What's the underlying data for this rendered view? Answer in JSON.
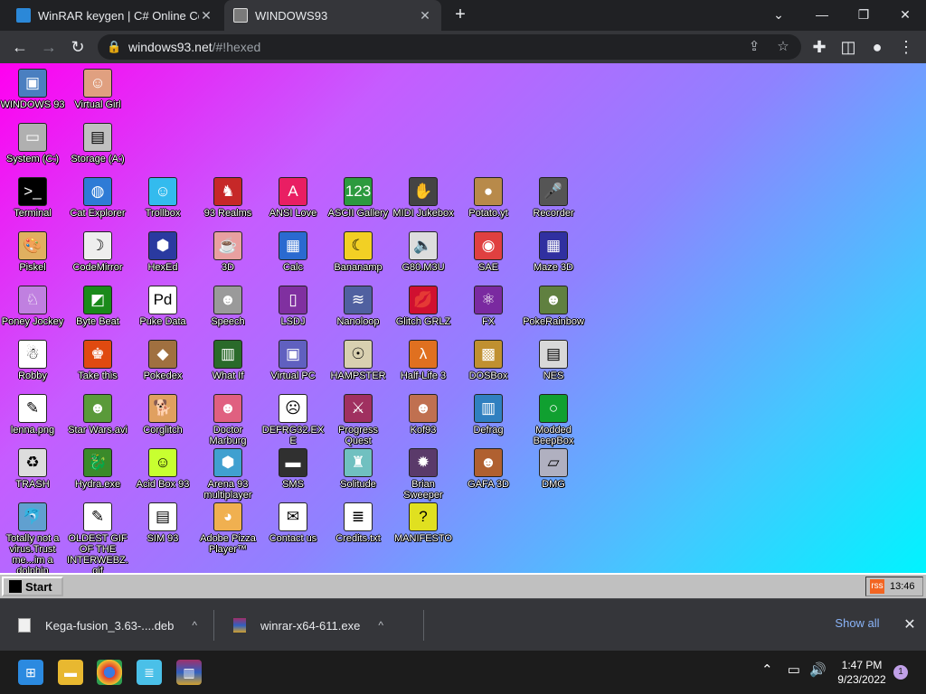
{
  "browser": {
    "tabs": [
      {
        "title": "WinRAR keygen | C# Online Com",
        "close": "✕"
      },
      {
        "title": "WINDOWS93",
        "close": "✕"
      }
    ],
    "new_tab": "+",
    "controls": {
      "chevron": "⌄",
      "minimize": "—",
      "maximize": "❐",
      "close": "✕"
    },
    "url_host": "windows93.net",
    "url_path": "/#!hexed"
  },
  "desktop": {
    "icons": [
      {
        "label": "WINDOWS 93",
        "icon": "computer-icon",
        "color": "#4a7fc0",
        "glyph": "▣"
      },
      {
        "label": "Virtual Girl",
        "icon": "face-icon",
        "color": "#e0a080",
        "glyph": "☺"
      },
      {
        "label": "System (C:)",
        "icon": "drive-icon",
        "color": "#b0b0b0",
        "glyph": "▭"
      },
      {
        "label": "Storage (A:)",
        "icon": "drive-icon",
        "color": "#c0c0c0",
        "glyph": "▤"
      },
      {
        "label": "Terminal",
        "icon": "terminal-icon",
        "color": "#000000",
        "glyph": ">_"
      },
      {
        "label": "Cat Explorer",
        "icon": "globe-icon",
        "color": "#2e7bd6",
        "glyph": "◍"
      },
      {
        "label": "Trollbox",
        "icon": "chat-icon",
        "color": "#33bbee",
        "glyph": "☺"
      },
      {
        "label": "93 Realms",
        "icon": "knight-icon",
        "color": "#c62828",
        "glyph": "♞"
      },
      {
        "label": "ANSI Love",
        "icon": "letter-a-icon",
        "color": "#e91e63",
        "glyph": "A"
      },
      {
        "label": "ASCII Gallery",
        "icon": "numbers-icon",
        "color": "#2c9a3e",
        "glyph": "123"
      },
      {
        "label": "MIDI Jukebox",
        "icon": "hand-icon",
        "color": "#444444",
        "glyph": "✋"
      },
      {
        "label": "Potato.yt",
        "icon": "potato-icon",
        "color": "#b88a4a",
        "glyph": "●"
      },
      {
        "label": "Recorder",
        "icon": "microphone-icon",
        "color": "#555555",
        "glyph": "🎤"
      },
      {
        "label": "Piskel",
        "icon": "palette-icon",
        "color": "#e0b060",
        "glyph": "🎨"
      },
      {
        "label": "CodeMirror",
        "icon": "codemirror-icon",
        "color": "#eeeeee",
        "glyph": "☽"
      },
      {
        "label": "HexEd",
        "icon": "cube-icon",
        "color": "#2a3aa0",
        "glyph": "⬢"
      },
      {
        "label": "3D",
        "icon": "teapot-icon",
        "color": "#e8a0a0",
        "glyph": "☕"
      },
      {
        "label": "Calc",
        "icon": "calculator-icon",
        "color": "#2a6ad0",
        "glyph": "▦"
      },
      {
        "label": "Bananamp",
        "icon": "banana-icon",
        "color": "#f2d024",
        "glyph": "☾"
      },
      {
        "label": "G80.M3U",
        "icon": "speaker-icon",
        "color": "#dddddd",
        "glyph": "🔈"
      },
      {
        "label": "SAE",
        "icon": "ball-icon",
        "color": "#e04040",
        "glyph": "◉"
      },
      {
        "label": "Maze 3D",
        "icon": "maze-icon",
        "color": "#3030a0",
        "glyph": "▦"
      },
      {
        "label": "Poney Jockey",
        "icon": "pony-icon",
        "color": "#c080e0",
        "glyph": "♘"
      },
      {
        "label": "Byte Beat",
        "icon": "bytebeat-icon",
        "color": "#1a8a1a",
        "glyph": "◩"
      },
      {
        "label": "Puke Data",
        "icon": "pd-icon",
        "color": "#ffffff",
        "glyph": "Pd"
      },
      {
        "label": "Speech",
        "icon": "head-icon",
        "color": "#9a9a9a",
        "glyph": "☻"
      },
      {
        "label": "LSDJ",
        "icon": "gameboy-icon",
        "color": "#8030a0",
        "glyph": "▯"
      },
      {
        "label": "Nanoloop",
        "icon": "wave-icon",
        "color": "#5060a0",
        "glyph": "≋"
      },
      {
        "label": "Glitch GRLZ",
        "icon": "lips-icon",
        "color": "#d01030",
        "glyph": "💋"
      },
      {
        "label": "FX",
        "icon": "atom-icon",
        "color": "#7a2aa0",
        "glyph": "⚛"
      },
      {
        "label": "PokeRainbow",
        "icon": "poke-icon",
        "color": "#608040",
        "glyph": "☻"
      },
      {
        "label": "Robby",
        "icon": "stickman-icon",
        "color": "#ffffff",
        "glyph": "☃"
      },
      {
        "label": "Take this",
        "icon": "sprite-icon",
        "color": "#e04a10",
        "glyph": "♚"
      },
      {
        "label": "Pokedex",
        "icon": "bag-icon",
        "color": "#a07040",
        "glyph": "◆"
      },
      {
        "label": "What If",
        "icon": "matrix-icon",
        "color": "#2a6a2a",
        "glyph": "▥"
      },
      {
        "label": "Virtual PC",
        "icon": "window-icon",
        "color": "#6060c0",
        "glyph": "▣"
      },
      {
        "label": "HAMPSTER",
        "icon": "owl-icon",
        "color": "#d8d0b0",
        "glyph": "☉"
      },
      {
        "label": "Half-Life 3",
        "icon": "halflife-icon",
        "color": "#e07020",
        "glyph": "λ"
      },
      {
        "label": "DOSBox",
        "icon": "dosbox-icon",
        "color": "#c09030",
        "glyph": "▩"
      },
      {
        "label": "NES",
        "icon": "nes-icon",
        "color": "#d8d8d8",
        "glyph": "▤"
      },
      {
        "label": "lenna.png",
        "icon": "image-file-icon",
        "color": "#ffffff",
        "glyph": "✎"
      },
      {
        "label": "Star Wars.avi",
        "icon": "yoda-icon",
        "color": "#5a9a3a",
        "glyph": "☻"
      },
      {
        "label": "Corglitch",
        "icon": "dog-icon",
        "color": "#e0a060",
        "glyph": "🐕"
      },
      {
        "label": "Doctor Marburg",
        "icon": "doctor-icon",
        "color": "#e06080",
        "glyph": "☻"
      },
      {
        "label": "DEFRG32.EXE",
        "icon": "screen-face-icon",
        "color": "#ffffff",
        "glyph": "☹"
      },
      {
        "label": "Progress Quest",
        "icon": "swords-icon",
        "color": "#a03060",
        "glyph": "⚔"
      },
      {
        "label": "Kof93",
        "icon": "fighter-icon",
        "color": "#c07050",
        "glyph": "☻"
      },
      {
        "label": "Defrag",
        "icon": "defrag-icon",
        "color": "#3080c0",
        "glyph": "▥"
      },
      {
        "label": "Modded BeepBox",
        "icon": "ring-icon",
        "color": "#10a030",
        "glyph": "○"
      },
      {
        "label": "TRASH",
        "icon": "trash-icon",
        "color": "#dddddd",
        "glyph": "♻"
      },
      {
        "label": "Hydra.exe",
        "icon": "dragon-icon",
        "color": "#3a8a2a",
        "glyph": "🐉"
      },
      {
        "label": "Acid Box 93",
        "icon": "smiley-icon",
        "color": "#c8ff30",
        "glyph": "☺"
      },
      {
        "label": "Arena 93 multiplayer",
        "icon": "cube-colors-icon",
        "color": "#40a0d0",
        "glyph": "⬢"
      },
      {
        "label": "SMS",
        "icon": "console-icon",
        "color": "#303030",
        "glyph": "▬"
      },
      {
        "label": "Solitude",
        "icon": "bottle-icon",
        "color": "#70c0c0",
        "glyph": "♜"
      },
      {
        "label": "Brian Sweeper",
        "icon": "mine-icon",
        "color": "#5a3a6a",
        "glyph": "✹"
      },
      {
        "label": "GAFA 3D",
        "icon": "doomguy-icon",
        "color": "#b06030",
        "glyph": "☻"
      },
      {
        "label": "DMG",
        "icon": "cartridge-icon",
        "color": "#b0b0c0",
        "glyph": "▱"
      },
      {
        "label": "Totally not a virus.Trust me...im a dolphin",
        "icon": "dolphin-icon",
        "color": "#60a0d0",
        "glyph": "🐬"
      },
      {
        "label": "OLDEST GIF OF THE INTERWEBZ.gif",
        "icon": "gif-file-icon",
        "color": "#ffffff",
        "glyph": "✎"
      },
      {
        "label": "SIM 93",
        "icon": "book-icon",
        "color": "#ffffff",
        "glyph": "▤"
      },
      {
        "label": "Adobe Pizza Player™",
        "icon": "pizza-icon",
        "color": "#f0b050",
        "glyph": "◕"
      },
      {
        "label": "Contact us",
        "icon": "note-icon",
        "color": "#ffffff",
        "glyph": "✉"
      },
      {
        "label": "Credits.txt",
        "icon": "text-file-icon",
        "color": "#ffffff",
        "glyph": "≣"
      },
      {
        "label": "MANIFESTO",
        "icon": "question-icon",
        "color": "#e0e020",
        "glyph": "?"
      }
    ]
  },
  "taskbar93": {
    "start": "Start",
    "time": "13:46",
    "rss": "rss"
  },
  "downloads": {
    "items": [
      {
        "name": "Kega-fusion_3.63-....deb"
      },
      {
        "name": "winrar-x64-611.exe"
      }
    ],
    "show_all": "Show all",
    "close": "✕",
    "chevron": "^"
  },
  "windows_taskbar": {
    "time": "1:47 PM",
    "date": "9/23/2022",
    "notifications": "1"
  }
}
